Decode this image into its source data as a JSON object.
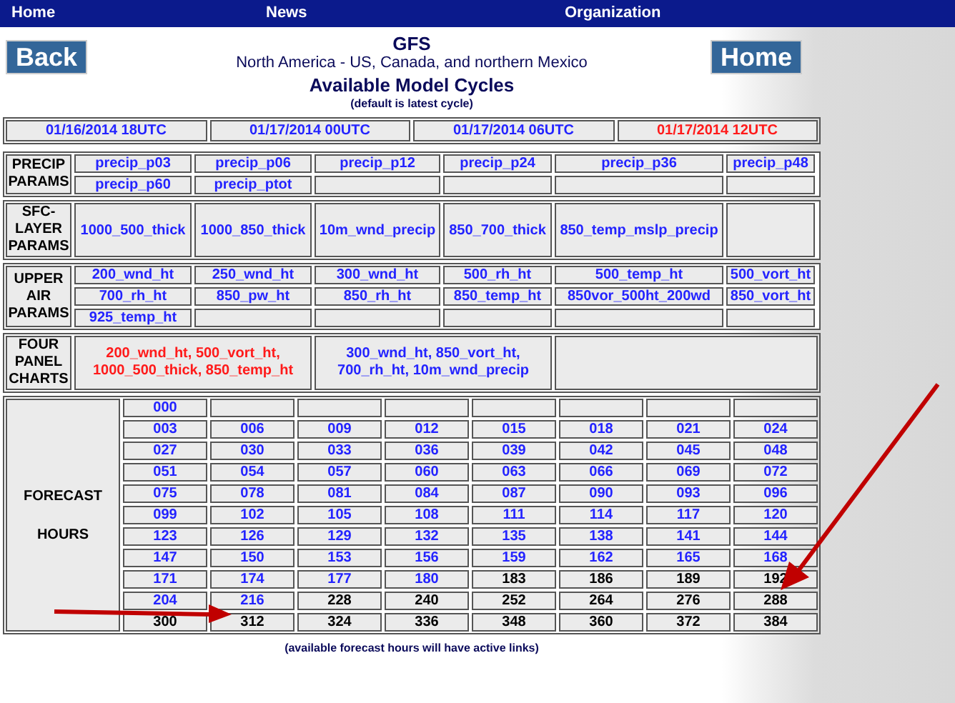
{
  "nav": [
    "Home",
    "News",
    "Organization"
  ],
  "back_button": "Back",
  "home_button": "Home",
  "title": "GFS",
  "region": "North America - US, Canada, and northern Mexico",
  "heading": "Available Model Cycles",
  "subheading": "(default is latest cycle)",
  "cycles": [
    {
      "label": "01/16/2014 18UTC",
      "selected": false
    },
    {
      "label": "01/17/2014 00UTC",
      "selected": false
    },
    {
      "label": "01/17/2014 06UTC",
      "selected": false
    },
    {
      "label": "01/17/2014 12UTC",
      "selected": true
    }
  ],
  "sections": [
    {
      "label": [
        "PRECIP",
        "PARAMS"
      ],
      "rows": [
        [
          "precip_p03",
          "precip_p06",
          "precip_p12",
          "precip_p24",
          "precip_p36",
          "precip_p48"
        ],
        [
          "precip_p60",
          "precip_ptot"
        ]
      ]
    },
    {
      "label": [
        "SFC-",
        "LAYER",
        "PARAMS"
      ],
      "rows": [
        [
          "1000_500_thick",
          "1000_850_thick",
          "10m_wnd_precip",
          "850_700_thick",
          "850_temp_mslp_precip"
        ]
      ]
    },
    {
      "label": [
        "UPPER",
        "AIR",
        "PARAMS"
      ],
      "rows": [
        [
          "200_wnd_ht",
          "250_wnd_ht",
          "300_wnd_ht",
          "500_rh_ht",
          "500_temp_ht",
          "500_vort_ht"
        ],
        [
          "700_rh_ht",
          "850_pw_ht",
          "850_rh_ht",
          "850_temp_ht",
          "850vor_500ht_200wd",
          "850_vort_ht"
        ],
        [
          "925_temp_ht"
        ]
      ]
    }
  ],
  "four_panel": {
    "label": [
      "FOUR",
      "PANEL",
      "CHARTS"
    ],
    "charts": [
      {
        "lines": [
          "200_wnd_ht, 500_vort_ht,",
          "1000_500_thick, 850_temp_ht"
        ],
        "selected": true
      },
      {
        "lines": [
          "300_wnd_ht, 850_vort_ht,",
          "700_rh_ht, 10m_wnd_precip"
        ],
        "selected": false
      }
    ]
  },
  "forecast": {
    "label": [
      "FORECAST",
      "HOURS"
    ],
    "rows": [
      [
        {
          "hour": "000",
          "active": true
        }
      ],
      [
        {
          "hour": "003",
          "active": true
        },
        {
          "hour": "006",
          "active": true
        },
        {
          "hour": "009",
          "active": true
        },
        {
          "hour": "012",
          "active": true
        },
        {
          "hour": "015",
          "active": true
        },
        {
          "hour": "018",
          "active": true
        },
        {
          "hour": "021",
          "active": true
        },
        {
          "hour": "024",
          "active": true
        }
      ],
      [
        {
          "hour": "027",
          "active": true
        },
        {
          "hour": "030",
          "active": true
        },
        {
          "hour": "033",
          "active": true
        },
        {
          "hour": "036",
          "active": true
        },
        {
          "hour": "039",
          "active": true
        },
        {
          "hour": "042",
          "active": true
        },
        {
          "hour": "045",
          "active": true
        },
        {
          "hour": "048",
          "active": true
        }
      ],
      [
        {
          "hour": "051",
          "active": true
        },
        {
          "hour": "054",
          "active": true
        },
        {
          "hour": "057",
          "active": true
        },
        {
          "hour": "060",
          "active": true
        },
        {
          "hour": "063",
          "active": true
        },
        {
          "hour": "066",
          "active": true
        },
        {
          "hour": "069",
          "active": true
        },
        {
          "hour": "072",
          "active": true
        }
      ],
      [
        {
          "hour": "075",
          "active": true
        },
        {
          "hour": "078",
          "active": true
        },
        {
          "hour": "081",
          "active": true
        },
        {
          "hour": "084",
          "active": true
        },
        {
          "hour": "087",
          "active": true
        },
        {
          "hour": "090",
          "active": true
        },
        {
          "hour": "093",
          "active": true
        },
        {
          "hour": "096",
          "active": true
        }
      ],
      [
        {
          "hour": "099",
          "active": true
        },
        {
          "hour": "102",
          "active": true
        },
        {
          "hour": "105",
          "active": true
        },
        {
          "hour": "108",
          "active": true
        },
        {
          "hour": "111",
          "active": true
        },
        {
          "hour": "114",
          "active": true
        },
        {
          "hour": "117",
          "active": true
        },
        {
          "hour": "120",
          "active": true
        }
      ],
      [
        {
          "hour": "123",
          "active": true
        },
        {
          "hour": "126",
          "active": true
        },
        {
          "hour": "129",
          "active": true
        },
        {
          "hour": "132",
          "active": true
        },
        {
          "hour": "135",
          "active": true
        },
        {
          "hour": "138",
          "active": true
        },
        {
          "hour": "141",
          "active": true
        },
        {
          "hour": "144",
          "active": true
        }
      ],
      [
        {
          "hour": "147",
          "active": true
        },
        {
          "hour": "150",
          "active": true
        },
        {
          "hour": "153",
          "active": true
        },
        {
          "hour": "156",
          "active": true
        },
        {
          "hour": "159",
          "active": true
        },
        {
          "hour": "162",
          "active": true
        },
        {
          "hour": "165",
          "active": true
        },
        {
          "hour": "168",
          "active": true
        }
      ],
      [
        {
          "hour": "171",
          "active": true
        },
        {
          "hour": "174",
          "active": true
        },
        {
          "hour": "177",
          "active": true
        },
        {
          "hour": "180",
          "active": true
        },
        {
          "hour": "183",
          "active": false
        },
        {
          "hour": "186",
          "active": false
        },
        {
          "hour": "189",
          "active": false
        },
        {
          "hour": "192",
          "active": false
        }
      ],
      [
        {
          "hour": "204",
          "active": true
        },
        {
          "hour": "216",
          "active": true
        },
        {
          "hour": "228",
          "active": false
        },
        {
          "hour": "240",
          "active": false
        },
        {
          "hour": "252",
          "active": false
        },
        {
          "hour": "264",
          "active": false
        },
        {
          "hour": "276",
          "active": false
        },
        {
          "hour": "288",
          "active": false
        }
      ],
      [
        {
          "hour": "300",
          "active": false
        },
        {
          "hour": "312",
          "active": false
        },
        {
          "hour": "324",
          "active": false
        },
        {
          "hour": "336",
          "active": false
        },
        {
          "hour": "348",
          "active": false
        },
        {
          "hour": "360",
          "active": false
        },
        {
          "hour": "372",
          "active": false
        },
        {
          "hour": "384",
          "active": false
        }
      ]
    ]
  },
  "footnote": "(available forecast hours will have active links)"
}
